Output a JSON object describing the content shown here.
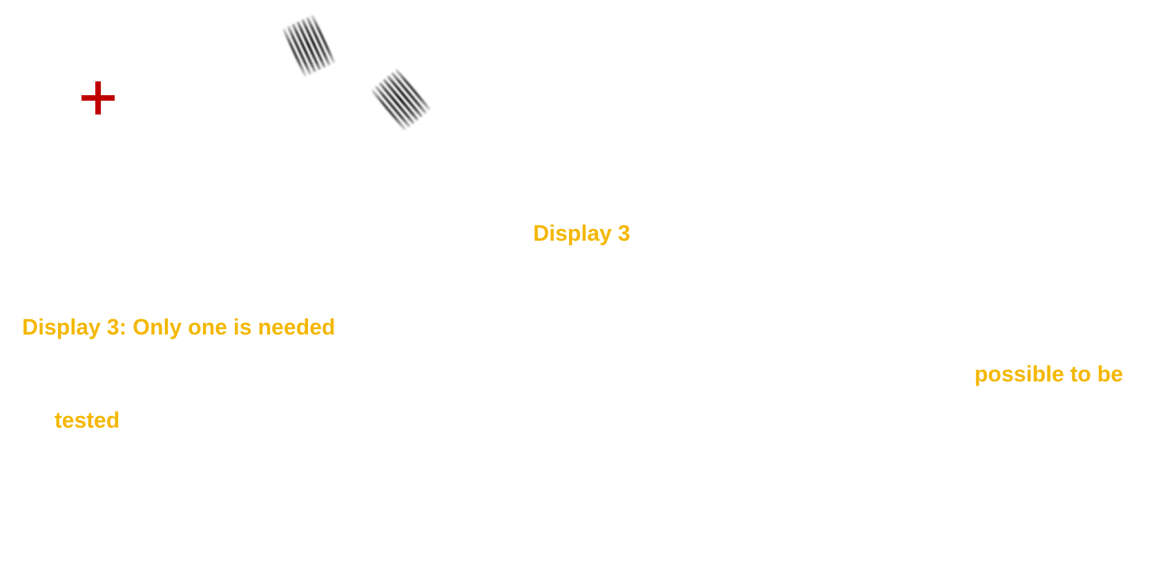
{
  "colors": {
    "text_accent": "#f4b700",
    "fixation": "#c00000",
    "background": "#ffffff",
    "grating": "#000000"
  },
  "stimuli": {
    "fixation_icon": "red-plus-cross",
    "gabor_icon": "gabor-patch"
  },
  "texts": {
    "display_title": "Display 3",
    "display_note": "Display 3: Only one is needed",
    "note_fragment_1": "possible to be",
    "note_fragment_2": "tested"
  }
}
